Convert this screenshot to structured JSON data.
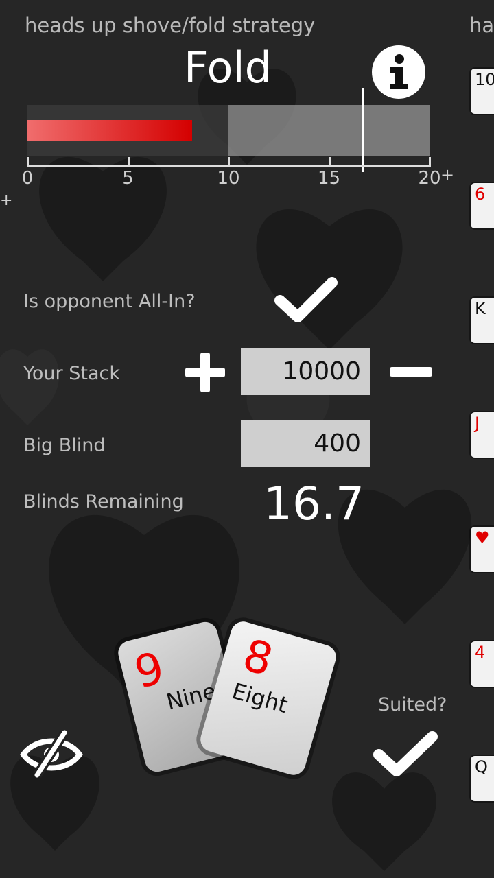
{
  "header": {
    "app_title": "heads up shove/fold strategy",
    "next_panel_title": "har",
    "action": "Fold"
  },
  "meter": {
    "fill_value": 8.2,
    "marker_value": 16.7,
    "max_value": 20,
    "fill_colors": [
      "#f06d6d",
      "#d40000"
    ],
    "ticks": [
      "0",
      "5",
      "10",
      "15",
      "20"
    ],
    "overflow_label": "+"
  },
  "form": {
    "opponent_all_in_label": "Is opponent All-In?",
    "opponent_all_in": true,
    "your_stack_label": "Your Stack",
    "your_stack_value": "10000",
    "big_blind_label": "Big Blind",
    "big_blind_value": "400",
    "blinds_remaining_label": "Blinds Remaining",
    "blinds_remaining_value": "16.7"
  },
  "hand": {
    "card1_rank": "9",
    "card1_name": "Nine",
    "card2_rank": "8",
    "card2_name": "Eight",
    "suited_label": "Suited?",
    "suited": true
  },
  "side_cards": [
    {
      "rank": "10",
      "color": "#111111"
    },
    {
      "rank": "6",
      "color": "#e00000"
    },
    {
      "rank": "K",
      "color": "#111111"
    },
    {
      "rank": "J",
      "color": "#e00000"
    },
    {
      "rank": "♥",
      "color": "#e00000"
    },
    {
      "rank": "4",
      "color": "#e00000"
    },
    {
      "rank": "Q",
      "color": "#111111"
    }
  ],
  "icons": {
    "info": "info-icon",
    "check": "checkmark-icon",
    "plus": "plus-icon",
    "minus": "minus-icon",
    "hide": "eye-slash-icon"
  }
}
